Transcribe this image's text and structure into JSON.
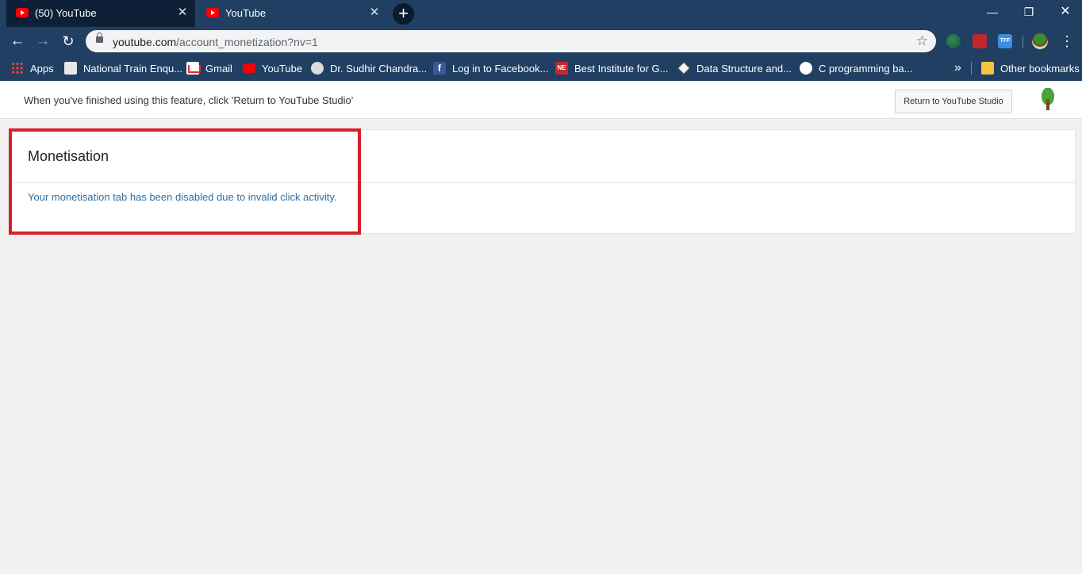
{
  "browser": {
    "tabs": [
      {
        "label": "(50) YouTube",
        "active": false
      },
      {
        "label": "YouTube",
        "active": true
      }
    ],
    "new_tab_icon": "+",
    "window_controls": {
      "minimize": "—",
      "maximize": "❐",
      "close": "✕"
    },
    "address": {
      "domain": "youtube.com",
      "path": "/account_monetization?nv=1"
    },
    "bookmarks": [
      {
        "label": "Apps",
        "icon": "apps-grid-icon"
      },
      {
        "label": "National Train Enqu...",
        "icon": "train-icon"
      },
      {
        "label": "Gmail",
        "icon": "gmail-icon"
      },
      {
        "label": "YouTube",
        "icon": "youtube-icon"
      },
      {
        "label": "Dr. Sudhir Chandra...",
        "icon": "site-icon"
      },
      {
        "label": "Log in to Facebook...",
        "icon": "facebook-icon"
      },
      {
        "label": "Best Institute for G...",
        "icon": "ne-icon"
      },
      {
        "label": "Data Structure and...",
        "icon": "ds-icon"
      },
      {
        "label": "C programming ba...",
        "icon": "globe-icon"
      }
    ],
    "bookmarks_overflow": "»",
    "other_bookmarks": "Other bookmarks"
  },
  "page": {
    "infobar_message": "When you've finished using this feature, click 'Return to YouTube Studio'",
    "return_button": "Return to YouTube Studio",
    "card_title": "Monetisation",
    "card_message": "Your monetisation tab has been disabled due to invalid click activity."
  },
  "colors": {
    "chrome_frame": "#203f62",
    "highlight_box": "#d9202a",
    "message_link": "#2f6ea3"
  }
}
